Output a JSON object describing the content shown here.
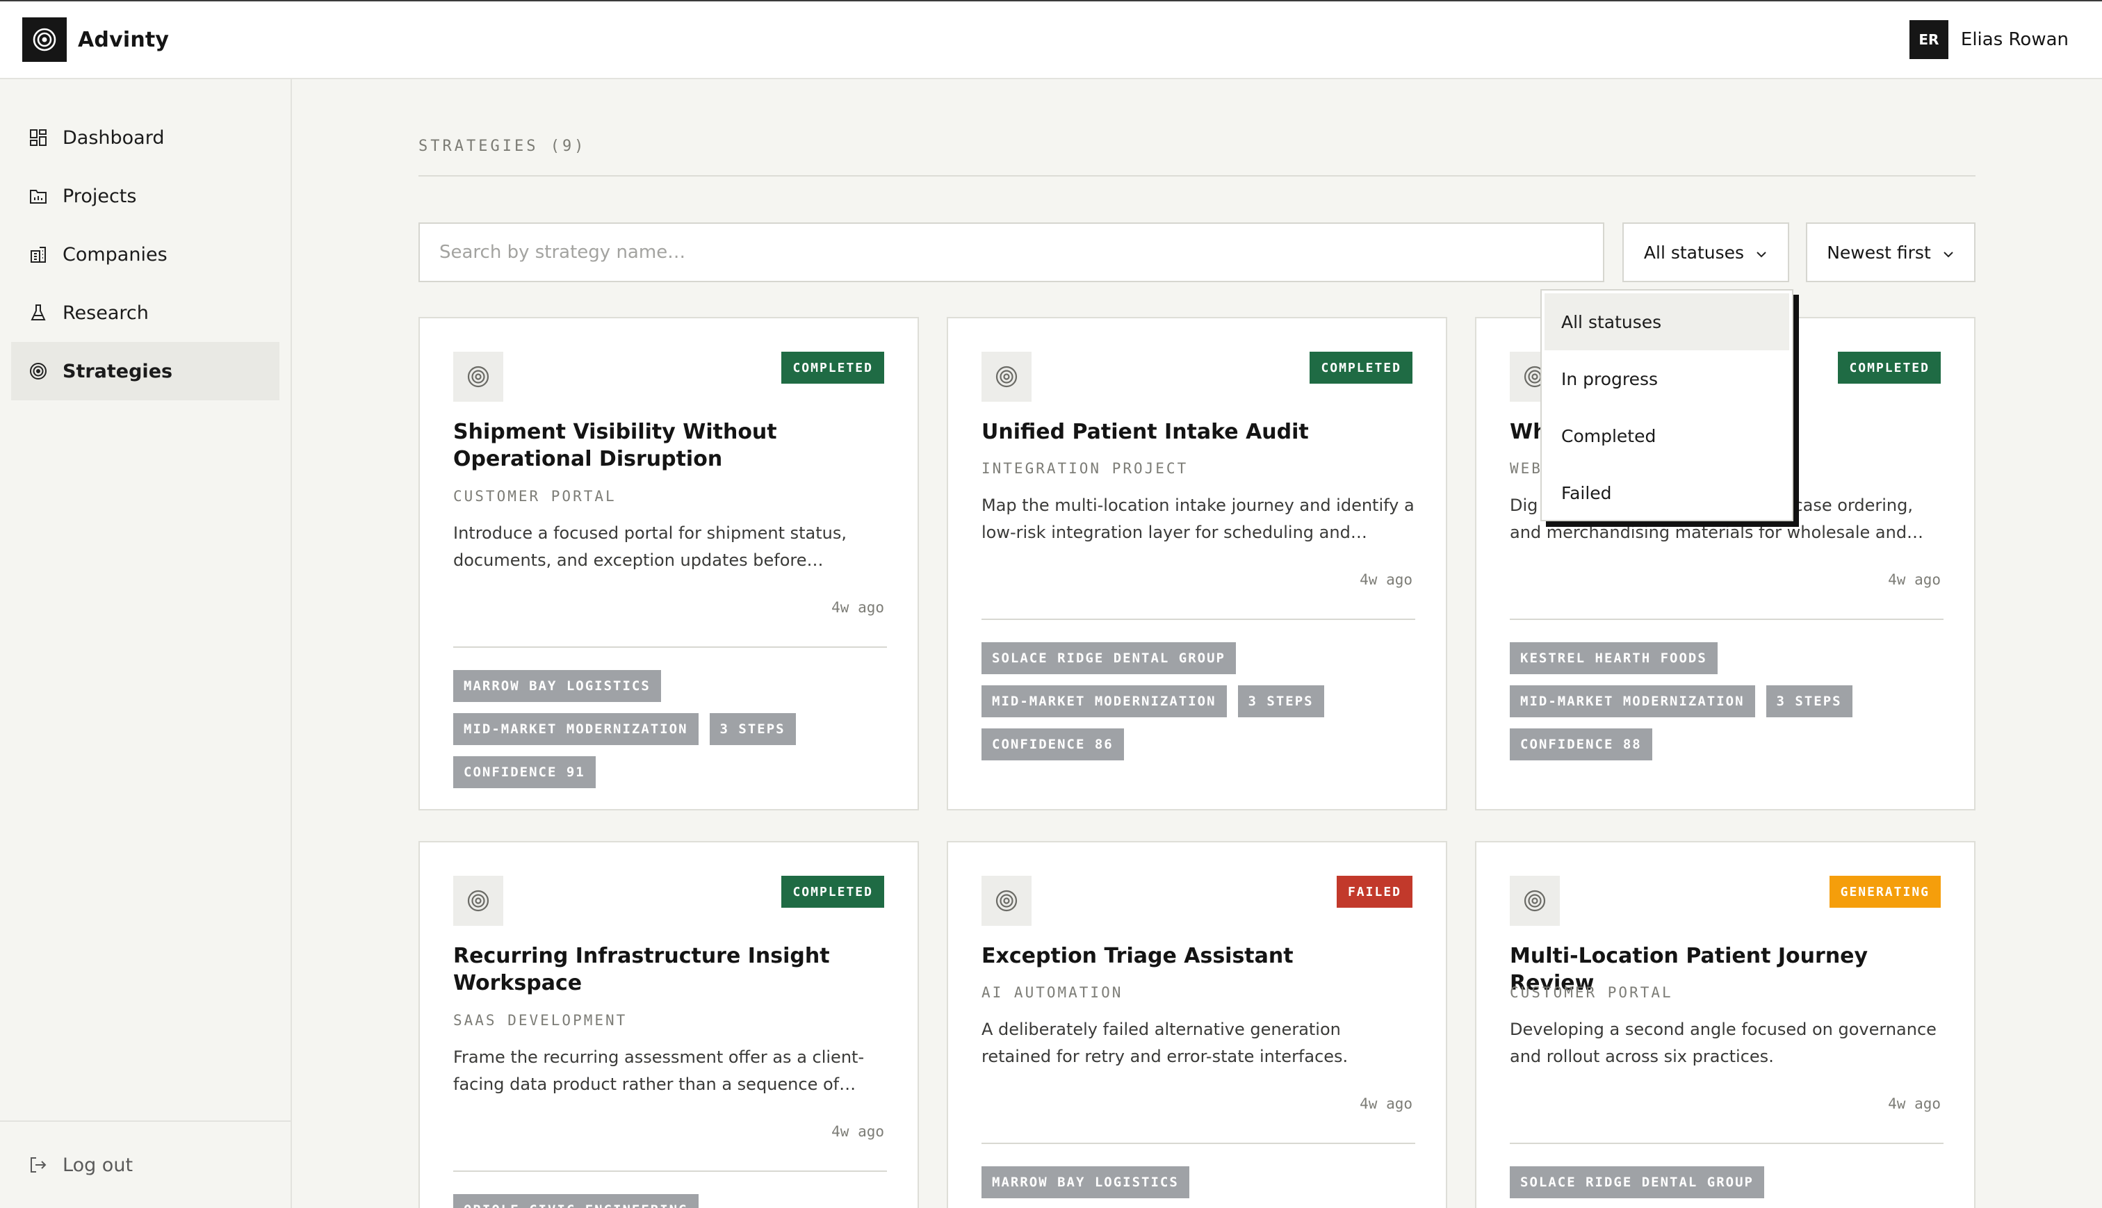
{
  "brand": {
    "name": "Advinty"
  },
  "user": {
    "initials": "ER",
    "name": "Elias Rowan"
  },
  "sidebar": {
    "items": [
      {
        "label": "Dashboard",
        "icon": "grid-icon"
      },
      {
        "label": "Projects",
        "icon": "folder-chart-icon"
      },
      {
        "label": "Companies",
        "icon": "building-icon"
      },
      {
        "label": "Research",
        "icon": "flask-icon"
      },
      {
        "label": "Strategies",
        "icon": "target-icon",
        "active": true
      }
    ],
    "logout": {
      "label": "Log out",
      "icon": "logout-icon"
    }
  },
  "main": {
    "section_title": "STRATEGIES (9)",
    "search": {
      "placeholder": "Search by strategy name…",
      "value": ""
    },
    "status_filter": {
      "selected": "All statuses"
    },
    "sort": {
      "selected": "Newest first"
    }
  },
  "dropdown": {
    "open": true,
    "options": [
      "All statuses",
      "In progress",
      "Completed",
      "Failed"
    ]
  },
  "colors": {
    "completed": "#1f6b44",
    "failed": "#c2392b",
    "generating": "#f59e0b",
    "tag": "#9fa2a6"
  },
  "cards": [
    {
      "title": "Shipment Visibility Without Operational Disruption",
      "subtitle": "CUSTOMER PORTAL",
      "status": "COMPLETED",
      "description": "Introduce a focused portal for shipment status, documents, and exception updates before…",
      "time": "4w ago",
      "tags": [
        "MARROW BAY LOGISTICS",
        "MID-MARKET MODERNIZATION",
        "3 STEPS",
        "CONFIDENCE 91"
      ]
    },
    {
      "title": "Unified Patient Intake Audit",
      "subtitle": "INTEGRATION PROJECT",
      "status": "COMPLETED",
      "description": "Map the multi-location intake journey and identify a low-risk integration layer for scheduling and…",
      "time": "4w ago",
      "tags": [
        "SOLACE RIDGE DENTAL GROUP",
        "MID-MARKET MODERNIZATION",
        "3 STEPS",
        "CONFIDENCE 86"
      ]
    },
    {
      "title": "Wh",
      "subtitle": "WEB",
      "status": "COMPLETED",
      "description_line1": "Dig",
      "description_line1_tail": "y, case ordering,",
      "description_line2": "and merchandising materials for wholesale and…",
      "time": "4w ago",
      "tags": [
        "KESTREL HEARTH FOODS",
        "MID-MARKET MODERNIZATION",
        "3 STEPS",
        "CONFIDENCE 88"
      ]
    },
    {
      "title": "Recurring Infrastructure Insight Workspace",
      "subtitle": "SAAS DEVELOPMENT",
      "status": "COMPLETED",
      "description": "Frame the recurring assessment offer as a client-facing data product rather than a sequence of…",
      "time": "4w ago",
      "tags": [
        "ORIOLE CIVIC ENGINEERING"
      ]
    },
    {
      "title": "Exception Triage Assistant",
      "subtitle": "AI AUTOMATION",
      "status": "FAILED",
      "description": "A deliberately failed alternative generation retained for retry and error-state interfaces.",
      "time": "4w ago",
      "tags": [
        "MARROW BAY LOGISTICS"
      ]
    },
    {
      "title": "Multi-Location Patient Journey Review",
      "subtitle": "CUSTOMER PORTAL",
      "status": "GENERATING",
      "description": "Developing a second angle focused on governance and rollout across six practices.",
      "time": "4w ago",
      "tags": [
        "SOLACE RIDGE DENTAL GROUP"
      ]
    }
  ]
}
